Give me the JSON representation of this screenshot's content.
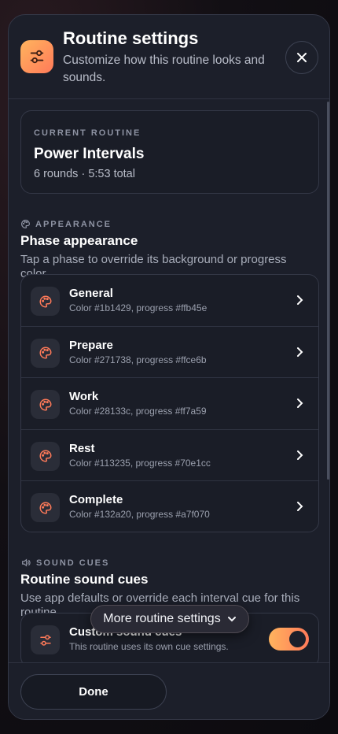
{
  "header": {
    "title": "Routine settings",
    "subtitle": "Customize how this routine looks and sounds.",
    "icon": "sliders-icon",
    "close_icon": "close-icon"
  },
  "current_routine": {
    "eyebrow": "CURRENT ROUTINE",
    "name": "Power Intervals",
    "meta": "6 rounds · 5:53 total"
  },
  "appearance": {
    "eyebrow": "APPEARANCE",
    "title": "Phase appearance",
    "description": "Tap a phase to override its background or progress color.",
    "phases": [
      {
        "name": "General",
        "detail": "Color #1b1429, progress #ffb45e"
      },
      {
        "name": "Prepare",
        "detail": "Color #271738, progress #ffce6b"
      },
      {
        "name": "Work",
        "detail": "Color #28133c, progress #ff7a59"
      },
      {
        "name": "Rest",
        "detail": "Color #113235, progress #70e1cc"
      },
      {
        "name": "Complete",
        "detail": "Color #132a20, progress #a7f070"
      }
    ]
  },
  "sound": {
    "eyebrow": "SOUND CUES",
    "title": "Routine sound cues",
    "description": "Use app defaults or override each interval cue for this routine.",
    "custom": {
      "name": "Custom sound cues",
      "detail": "This routine uses its own cue settings.",
      "enabled": true
    }
  },
  "more_button": {
    "label": "More routine settings",
    "icon": "chevron-down-icon"
  },
  "footer": {
    "done_label": "Done"
  },
  "colors": {
    "accent_start": "#ffb45e",
    "accent_end": "#ff7a59",
    "sheet_bg": "#1c1f2a",
    "icon_accent": "#ff7a59"
  }
}
